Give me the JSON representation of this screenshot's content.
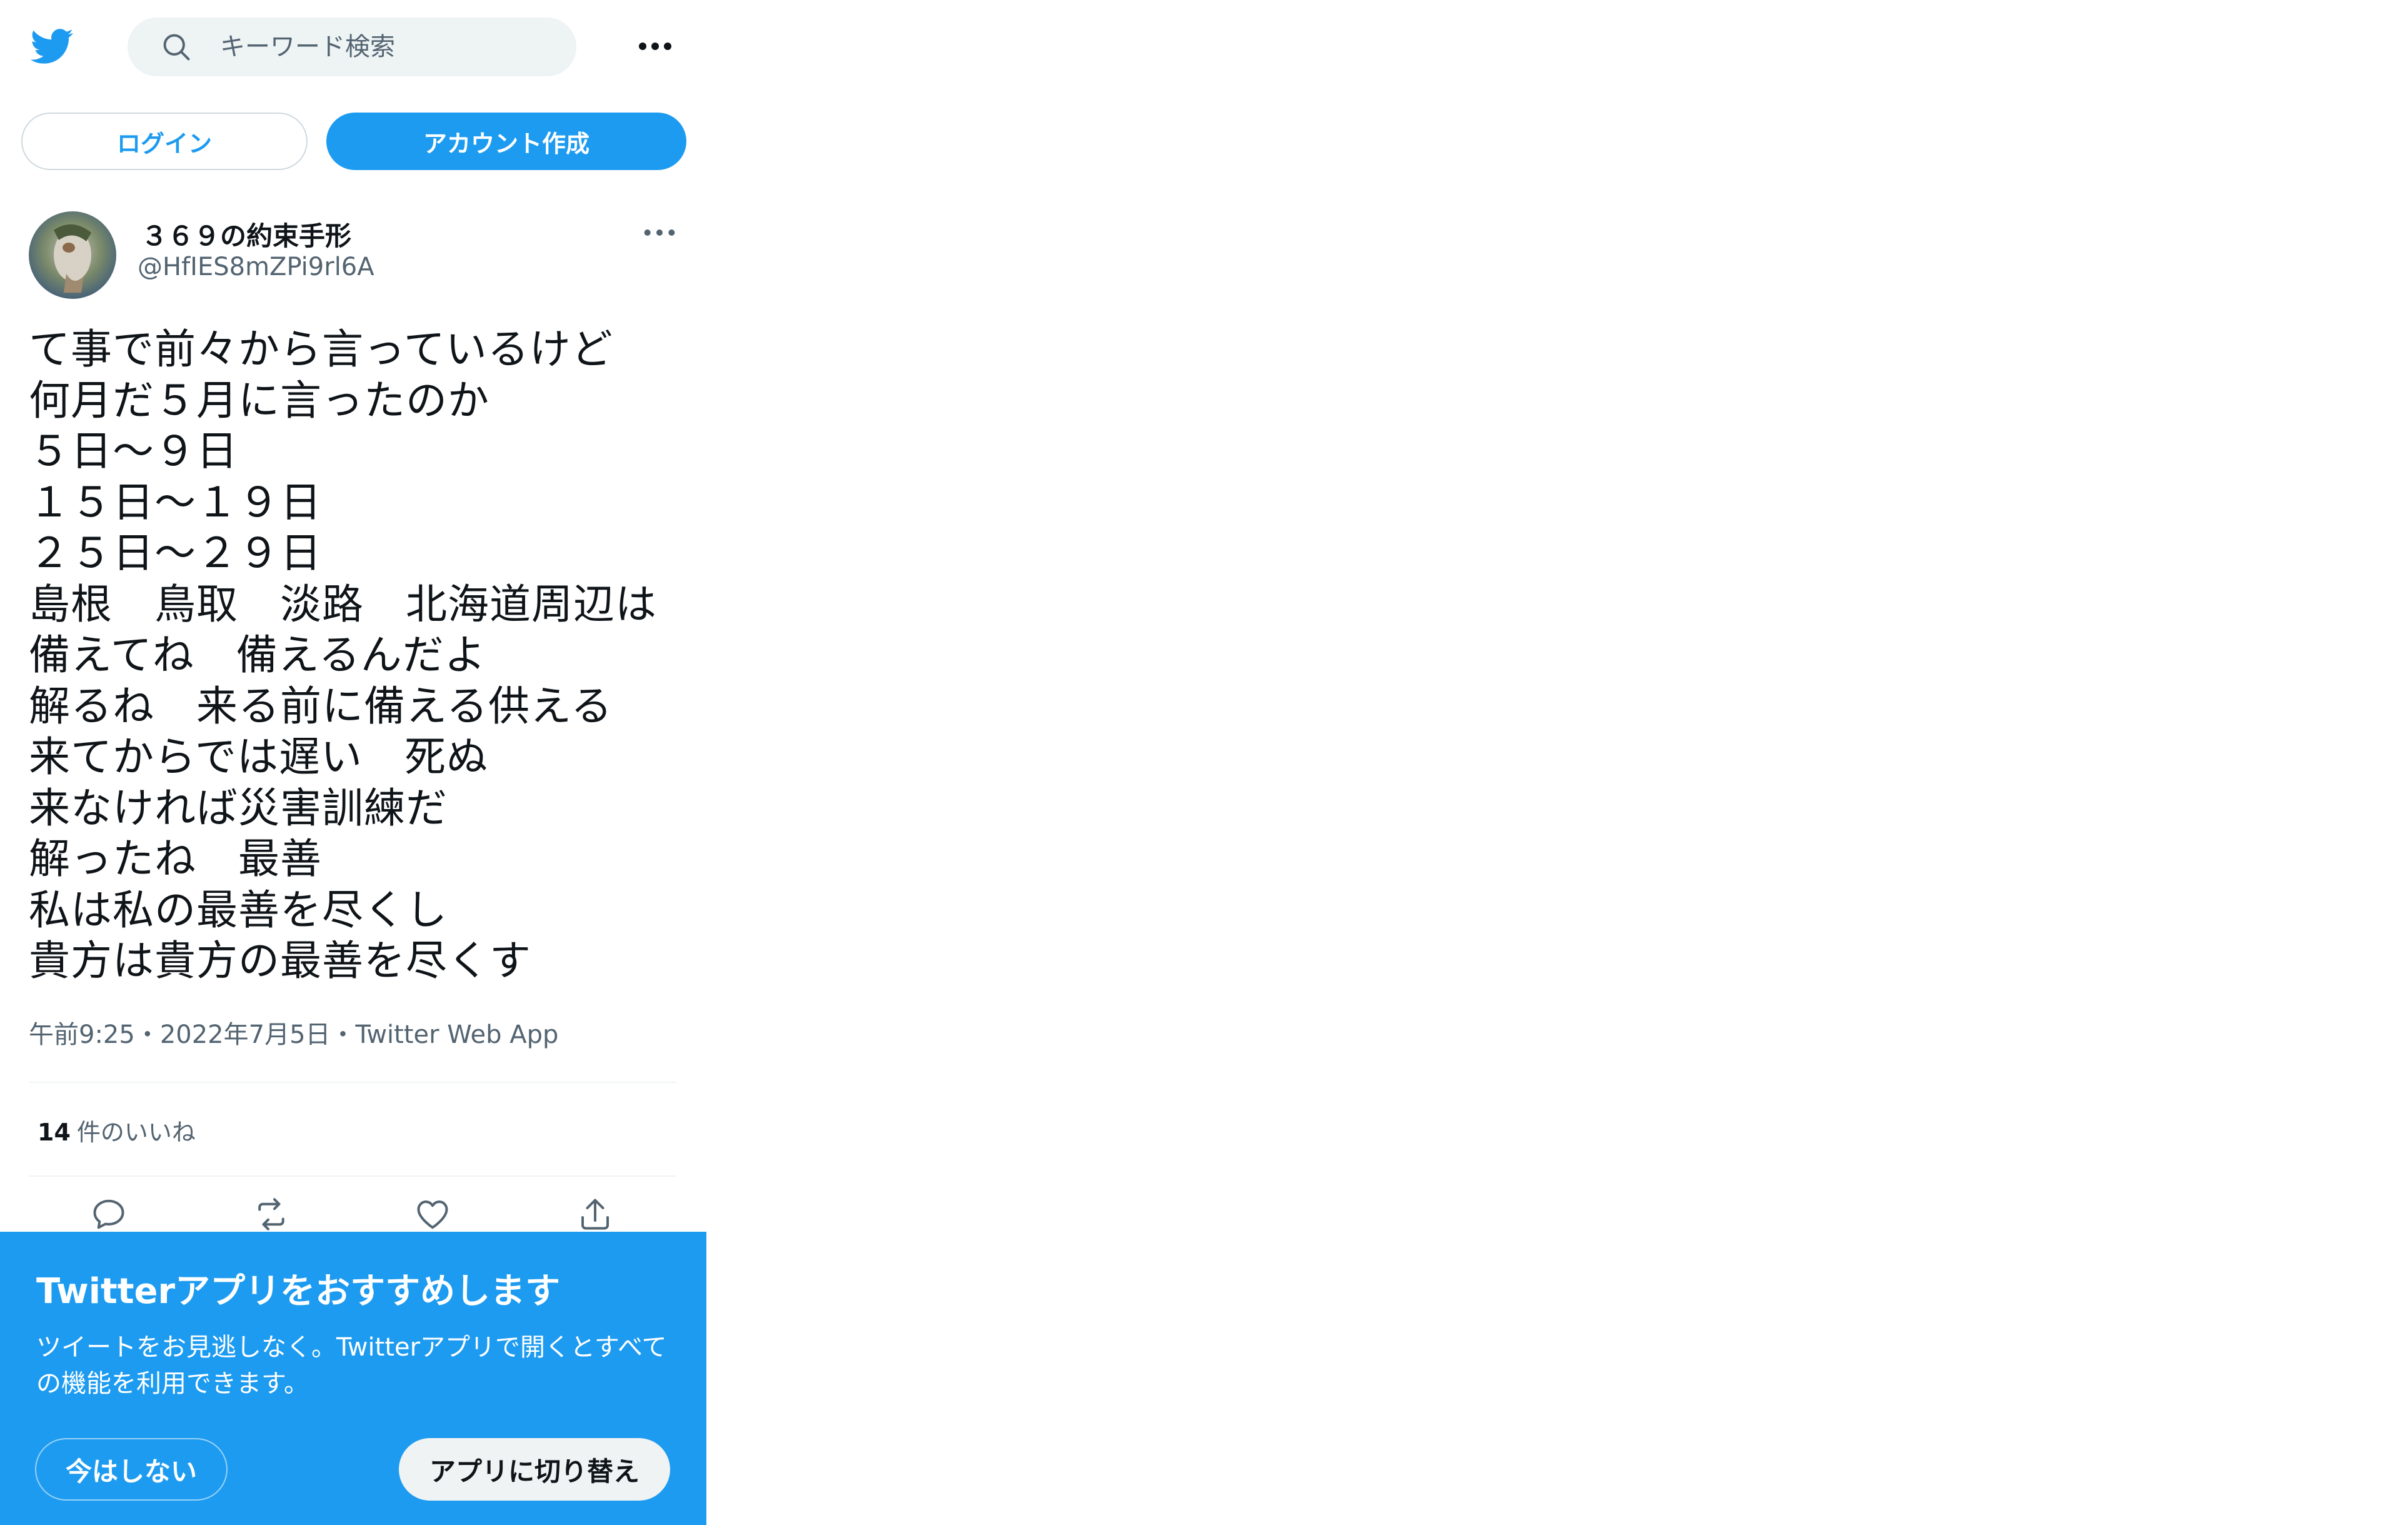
{
  "search": {
    "placeholder": "キーワード検索"
  },
  "auth": {
    "login_label": "ログイン",
    "signup_label": "アカウント作成"
  },
  "tweet": {
    "display_name": "３６９の約束手形",
    "handle": "@HfIES8mZPi9rl6A",
    "lines": [
      "て事で前々から言っているけど",
      "何月だ５月に言ったのか",
      "５日～９日",
      "１５日～１９日",
      "２５日～２９日",
      "島根　鳥取　淡路　北海道周辺は",
      "備えてね　備えるんだよ",
      "解るね　来る前に備える供える",
      "来てからでは遅い　死ぬ",
      "来なければ災害訓練だ",
      "解ったね　最善",
      "私は私の最善を尽くし",
      "貴方は貴方の最善を尽くす"
    ],
    "time": "午前9:25",
    "date": "2022年7月5日",
    "source": "Twitter Web App",
    "separator": "・",
    "like_count": "14",
    "like_label": "件のいいね"
  },
  "promo": {
    "title": "Twitterアプリをおすすめします",
    "body": "ツイートをお見逃しなく。Twitterアプリで開くとすべての機能を利用できます。",
    "not_now_label": "今はしない",
    "switch_label": "アプリに切り替え"
  },
  "colors": {
    "brand": "#1d9bf0",
    "text": "#0f1419",
    "muted": "#536471"
  }
}
